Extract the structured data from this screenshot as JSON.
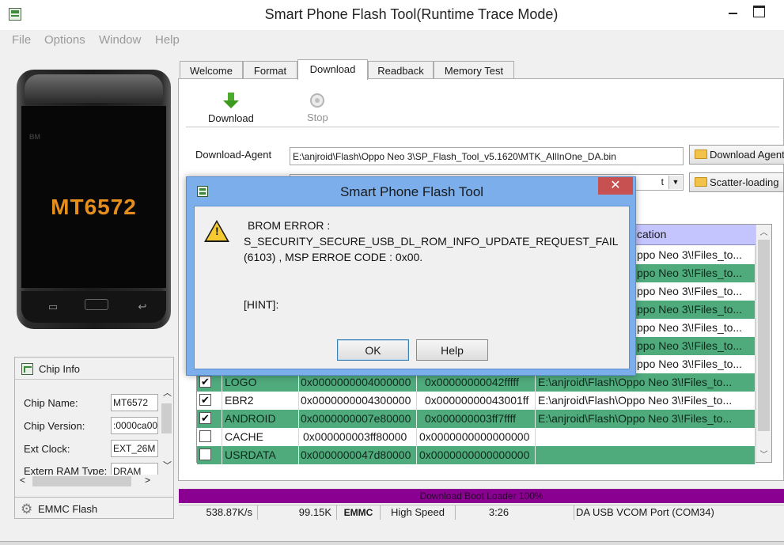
{
  "window": {
    "title": "Smart Phone Flash Tool(Runtime Trace Mode)"
  },
  "menu": [
    "File",
    "Options",
    "Window",
    "Help"
  ],
  "phone": {
    "model": "MT6572",
    "brand": "BM"
  },
  "chip_info": {
    "title": "Chip Info",
    "fields": [
      {
        "label": "Chip Name:",
        "value": "MT6572"
      },
      {
        "label": "Chip Version:",
        "value": ":0000ca00"
      },
      {
        "label": "Ext Clock:",
        "value": "EXT_26M"
      },
      {
        "label": "Extern RAM Type:",
        "value": "DRAM"
      }
    ],
    "emmc_label": "EMMC Flash"
  },
  "tabs": [
    {
      "label": "Welcome",
      "active": false
    },
    {
      "label": "Format",
      "active": false
    },
    {
      "label": "Download",
      "active": true
    },
    {
      "label": "Readback",
      "active": false
    },
    {
      "label": "Memory Test",
      "active": false
    }
  ],
  "toolbar": {
    "download_label": "Download",
    "stop_label": "Stop"
  },
  "download_agent": {
    "label": "Download-Agent",
    "path": "E:\\anjroid\\Flash\\Oppo Neo 3\\SP_Flash_Tool_v5.1620\\MTK_AllInOne_DA.bin",
    "button": "Download Agent"
  },
  "scatter": {
    "select_text": "t",
    "button": "Scatter-loading"
  },
  "table": {
    "location_header": "cation",
    "partial_locations": [
      "ppo Neo 3\\!Files_to...",
      "ppo Neo 3\\!Files_to...",
      "ppo Neo 3\\!Files_to...",
      "ppo Neo 3\\!Files_to...",
      "ppo Neo 3\\!Files_to...",
      "ppo Neo 3\\!Files_to...",
      "ppo Neo 3\\!Files_to..."
    ],
    "rows": [
      {
        "checked": true,
        "name": "LOGO",
        "begin": "0x0000000004000000",
        "end": "0x00000000042fffff",
        "location": "E:\\anjroid\\Flash\\Oppo Neo 3\\!Files_to..."
      },
      {
        "checked": true,
        "name": "EBR2",
        "begin": "0x0000000004300000",
        "end": "0x00000000043001ff",
        "location": "E:\\anjroid\\Flash\\Oppo Neo 3\\!Files_to..."
      },
      {
        "checked": true,
        "name": "ANDROID",
        "begin": "0x0000000007e80000",
        "end": "0x000000003ff7ffff",
        "location": "E:\\anjroid\\Flash\\Oppo Neo 3\\!Files_to..."
      },
      {
        "checked": false,
        "name": "CACHE",
        "begin": "0x000000003ff80000",
        "end": "0x0000000000000000",
        "location": ""
      },
      {
        "checked": false,
        "name": "USRDATA",
        "begin": "0x0000000047d80000",
        "end": "0x0000000000000000",
        "location": ""
      }
    ]
  },
  "progress": {
    "text": "Download Boot Loader 100%",
    "fraction": 1.0,
    "color": "#8a0090"
  },
  "status": {
    "speed": "538.87K/s",
    "size": "99.15K",
    "storage": "EMMC",
    "usb_speed": "High Speed",
    "time": "3:26",
    "port": "DA USB VCOM Port (COM34)"
  },
  "dialog": {
    "title": "Smart Phone Flash Tool",
    "lines": [
      "BROM ERROR :",
      "S_SECURITY_SECURE_USB_DL_ROM_INFO_UPDATE_REQUEST_FAIL",
      "(6103) , MSP ERROE CODE : 0x00."
    ],
    "hint": "[HINT]:",
    "ok_label": "OK",
    "help_label": "Help",
    "close_glyph": "✕"
  },
  "icons": [
    "app-icon",
    "chip-icon",
    "gear-icon",
    "download-arrow-icon",
    "stop-icon",
    "folder-icon",
    "warning-icon",
    "close-icon"
  ]
}
